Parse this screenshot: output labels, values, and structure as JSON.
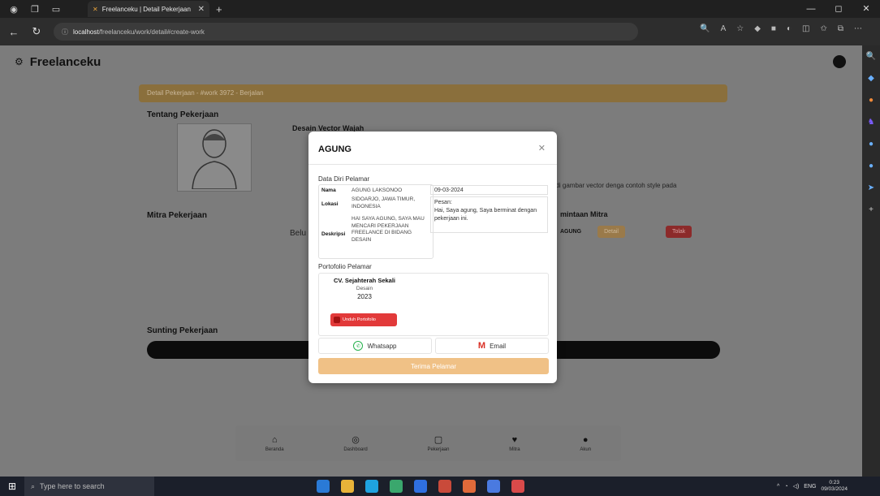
{
  "browser": {
    "tab_title": "Freelanceku | Detail Pekerjaan",
    "url_host": "localhost",
    "url_path": "/freelanceku/work/detail#create-work"
  },
  "app": {
    "brand": "Freelanceku"
  },
  "page": {
    "banner": "Detail Pekerjaan - #work 3972 - Berjalan",
    "about_title": "Tentang Pekerjaan",
    "job_title": "Desain Vector Wajah",
    "job_desc_tail": "adi gambar vector denga contoh style pada",
    "mitra_title": "Mitra Pekerjaan",
    "mitra_empty_prefix": "Belu",
    "permintaan_title": "mintaan Mitra",
    "permintaan_name": "AGUNG",
    "detail_btn": "Detail",
    "tolak_btn": "Tolak",
    "edit_title": "Sunting Pekerjaan"
  },
  "bottom_nav": [
    {
      "label": "Beranda",
      "icon": "home-icon"
    },
    {
      "label": "Dashboard",
      "icon": "dashboard-icon"
    },
    {
      "label": "Pekerjaan",
      "icon": "briefcase-icon"
    },
    {
      "label": "Mitra",
      "icon": "handshake-icon"
    },
    {
      "label": "Akun",
      "icon": "user-icon"
    }
  ],
  "modal": {
    "title": "AGUNG",
    "data_label": "Data Diri Pelamar",
    "nama_key": "Nama",
    "nama_val": "AGUNG LAKSONOO",
    "lokasi_key": "Lokasi",
    "lokasi_val": "SIDOARJO, JAWA TIMUR, INDONESIA",
    "deskripsi_key": "Deskripsi",
    "deskripsi_val": "HAI SAYA AGUNG, SAYA MAU MENCARI PEKERJAAN FREELANCE DI BIDANG DESAIN",
    "date": "09-03-2024",
    "pesan_label": "Pesan:",
    "pesan_text": "Hai, Saya agung, Saya berminat dengan pekerjaan ini.",
    "portfolio_label": "Portofolio Pelamar",
    "portfolio": {
      "company": "CV. Sejahterah Sekali",
      "category": "Desain",
      "year": "2023",
      "download": "Unduh Portofolio"
    },
    "whatsapp": "Whatsapp",
    "email": "Email",
    "accept": "Terima Pelamar"
  },
  "taskbar": {
    "search_placeholder": "Type here to search",
    "lang": "ENG",
    "time": "0:23",
    "date": "09/03/2024"
  }
}
